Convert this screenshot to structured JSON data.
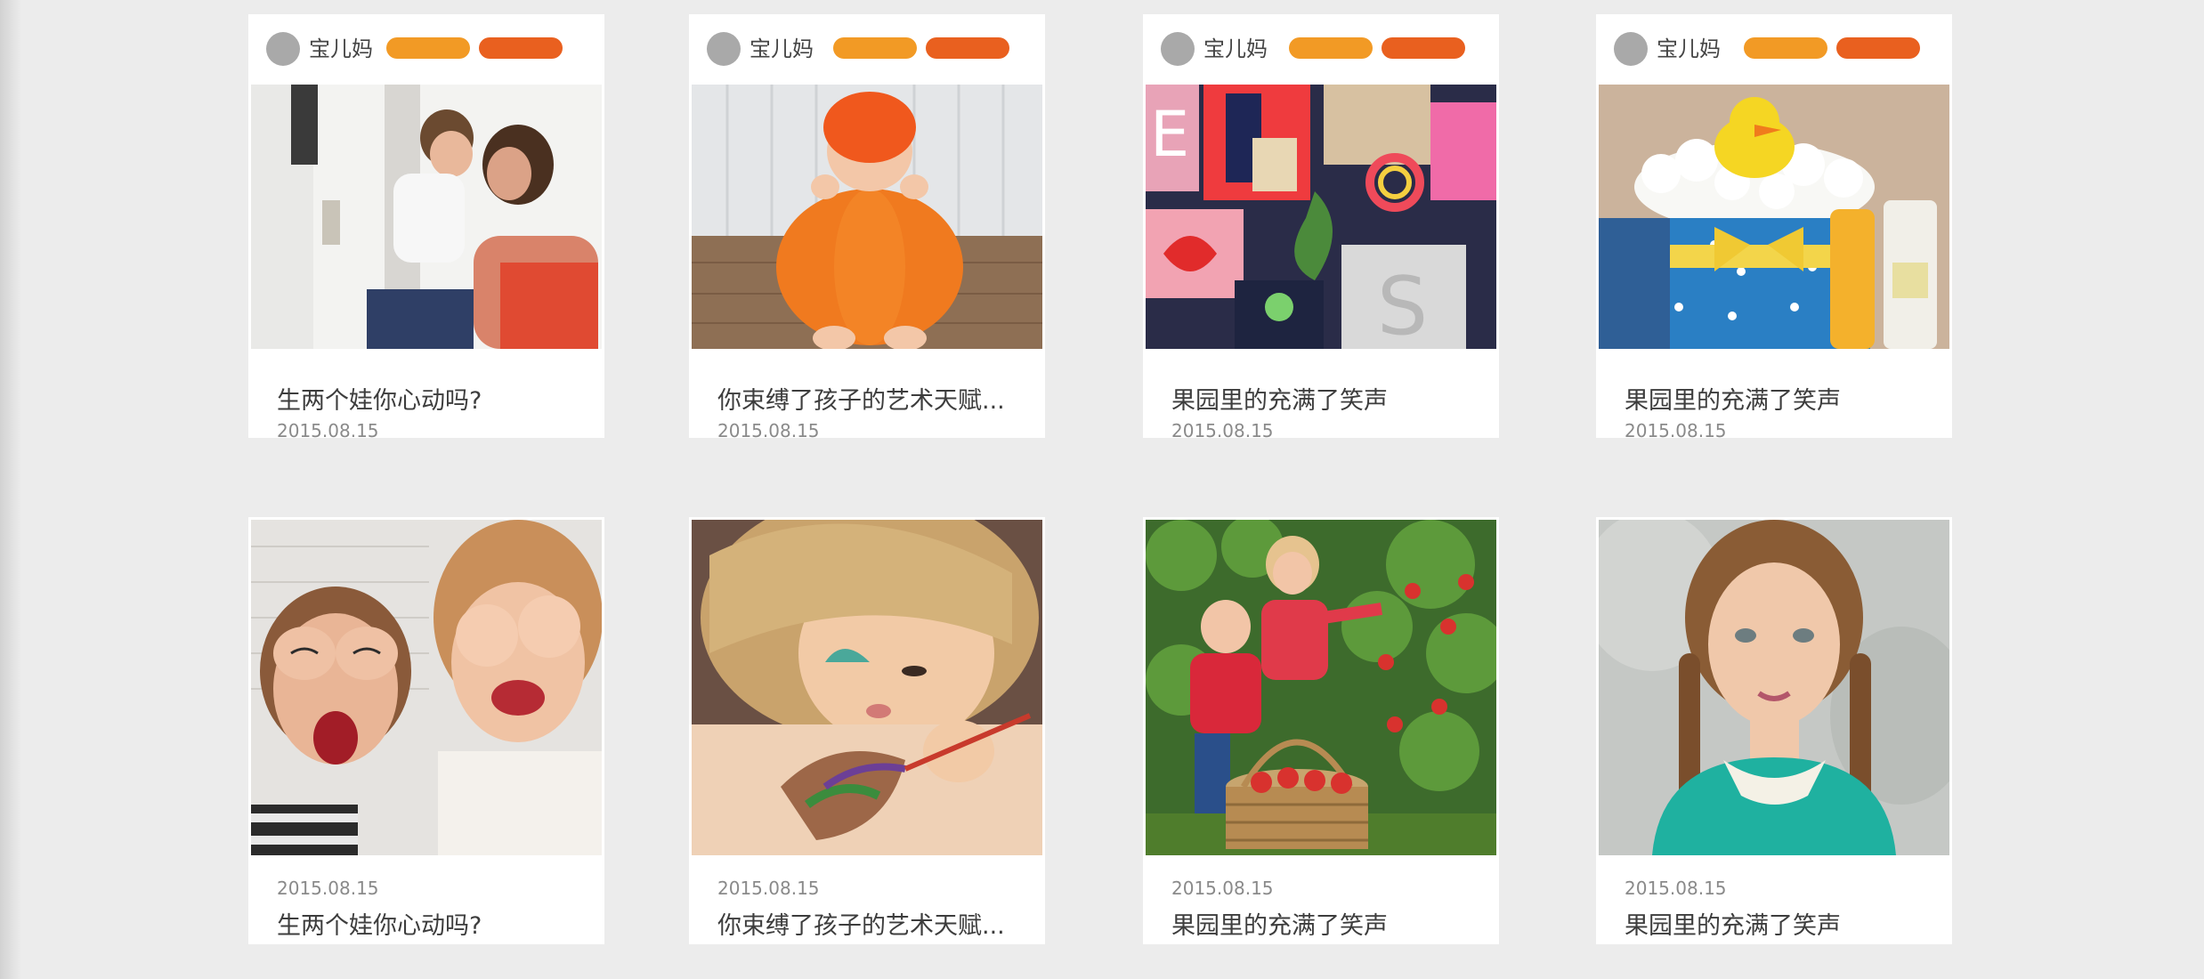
{
  "colors": {
    "pill_primary": "#f29a25",
    "pill_secondary": "#e9601f",
    "avatar": "#a9a9a9",
    "page_bg": "#ececec"
  },
  "cards": [
    {
      "user": "宝儿妈",
      "title": "生两个娃你心动吗?",
      "date": "2015.08.15",
      "image": "mother-kissing-child-photo"
    },
    {
      "user": "宝儿妈",
      "title": "你束缚了孩子的艺术天赋...",
      "date": "2015.08.15",
      "image": "baby-in-pumpkin-photo"
    },
    {
      "user": "宝儿妈",
      "title": "果园里的充满了笑声",
      "date": "2015.08.15",
      "image": "colorful-paper-shapes-photo"
    },
    {
      "user": "宝儿妈",
      "title": "果园里的充满了笑声",
      "date": "2015.08.15",
      "image": "rubber-duck-diaper-cake-photo"
    },
    {
      "title": "生两个娃你心动吗?",
      "date": "2015.08.15",
      "image": "girls-covering-eyes-photo"
    },
    {
      "title": "你束缚了孩子的艺术天赋...",
      "date": "2015.08.15",
      "image": "child-painting-photo"
    },
    {
      "title": "果园里的充满了笑声",
      "date": "2015.08.15",
      "image": "kids-picking-apples-photo"
    },
    {
      "title": "果园里的充满了笑声",
      "date": "2015.08.15",
      "image": "girl-with-braids-photo"
    }
  ]
}
